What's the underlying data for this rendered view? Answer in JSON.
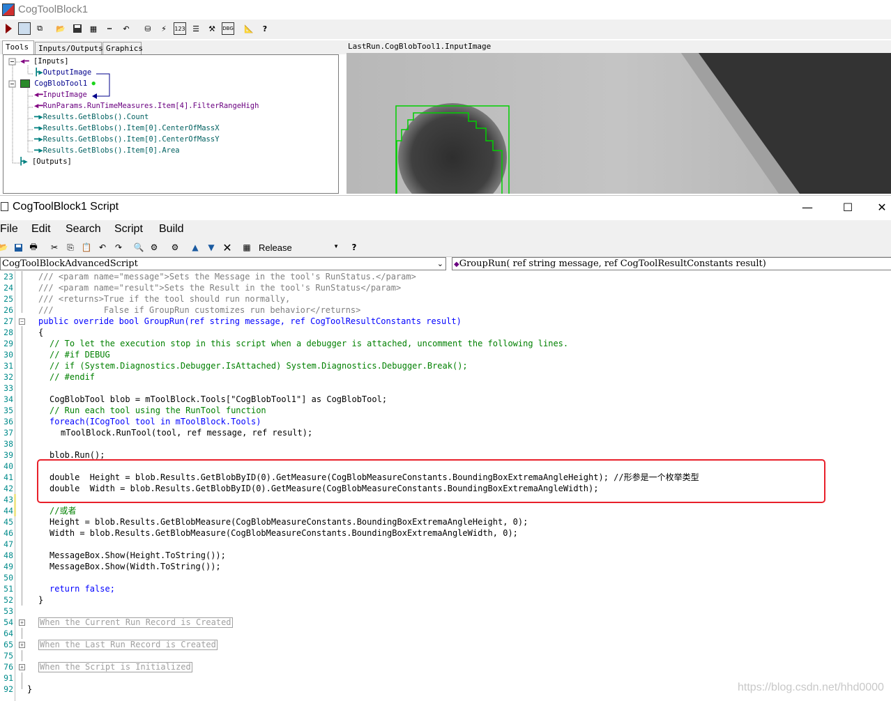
{
  "toolblock": {
    "title": "CogToolBlock1",
    "tabs": [
      "Tools",
      "Inputs/Outputs",
      "Graphics"
    ],
    "tree": {
      "inputs": "[Inputs]",
      "output_image": "OutputImage",
      "blob_tool": "CogBlobTool1",
      "input_image": "InputImage",
      "filter_range": "RunParams.RunTimeMeasures.Item[4].FilterRangeHigh",
      "count": "Results.GetBlobs().Count",
      "cx": "Results.GetBlobs().Item[0].CenterOfMassX",
      "cy": "Results.GetBlobs().Item[0].CenterOfMassY",
      "area": "Results.GetBlobs().Item[0].Area",
      "outputs": "[Outputs]"
    },
    "viewer_title": "LastRun.CogBlobTool1.InputImage"
  },
  "script_window": {
    "title": "CogToolBlock1 Script",
    "menu": [
      "File",
      "Edit",
      "Search",
      "Script",
      "Build"
    ],
    "config": "Release",
    "class_combo": "CogToolBlockAdvancedScript",
    "method_combo": "GroupRun( ref string message,  ref CogToolResultConstants result)"
  },
  "code": {
    "line_numbers": [
      "23",
      "24",
      "25",
      "26",
      "27",
      "28",
      "29",
      "30",
      "31",
      "32",
      "33",
      "34",
      "35",
      "36",
      "37",
      "38",
      "39",
      "40",
      "41",
      "42",
      "43",
      "44",
      "45",
      "46",
      "47",
      "48",
      "49",
      "50",
      "51",
      "52",
      "53",
      "54",
      "64",
      "65",
      "75",
      "76",
      "91",
      "92"
    ],
    "l23": "/// <param name=\"message\">Sets the Message in the tool's RunStatus.</param>",
    "l24": "/// <param name=\"result\">Sets the Result in the tool's RunStatus</param>",
    "l25": "/// <returns>True if the tool should run normally,",
    "l26": "///          False if GroupRun customizes run behavior</returns>",
    "l27": "public override bool GroupRun(ref string message, ref CogToolResultConstants result)",
    "l28": "{",
    "l29": "// To let the execution stop in this script when a debugger is attached, uncomment the following lines.",
    "l30": "// #if DEBUG",
    "l31": "// if (System.Diagnostics.Debugger.IsAttached) System.Diagnostics.Debugger.Break();",
    "l32": "// #endif",
    "l34": "CogBlobTool blob = mToolBlock.Tools[\"CogBlobTool1\"] as CogBlobTool;",
    "l35": "// Run each tool using the RunTool function",
    "l36": "foreach(ICogTool tool in mToolBlock.Tools)",
    "l37": "mToolBlock.RunTool(tool, ref message, ref result);",
    "l39": "blob.Run();",
    "l41": "double  Height = blob.Results.GetBlobByID(0).GetMeasure(CogBlobMeasureConstants.BoundingBoxExtremaAngleHeight); //形参是一个枚举类型",
    "l42": "double  Width = blob.Results.GetBlobByID(0).GetMeasure(CogBlobMeasureConstants.BoundingBoxExtremaAngleWidth);",
    "l44": "//或者",
    "l45": "Height = blob.Results.GetBlobMeasure(CogBlobMeasureConstants.BoundingBoxExtremaAngleHeight, 0);",
    "l46": "Width = blob.Results.GetBlobMeasure(CogBlobMeasureConstants.BoundingBoxExtremaAngleWidth, 0);",
    "l48": "MessageBox.Show(Height.ToString());",
    "l49": "MessageBox.Show(Width.ToString());",
    "l51": "return false;",
    "l52": "}",
    "l54": "When the Current Run Record is Created",
    "l65": "When the Last Run Record is Created",
    "l76": "When the Script is Initialized",
    "l92": "}"
  },
  "watermark": "https://blog.csdn.net/hhd0000"
}
